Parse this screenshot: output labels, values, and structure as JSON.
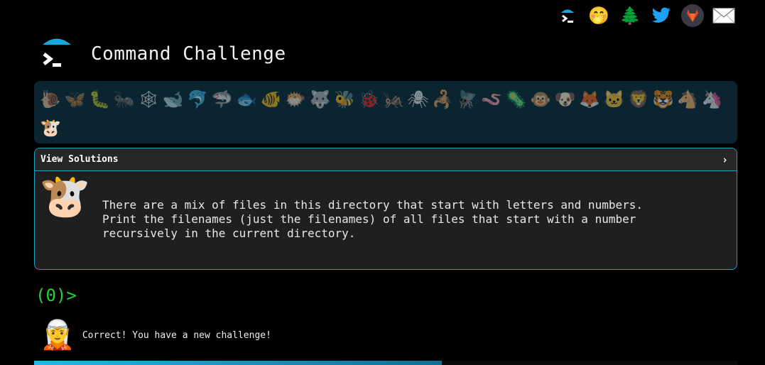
{
  "app": {
    "title": "Command Challenge"
  },
  "top_links": [
    {
      "name": "logo-icon",
      "glyph": "terminal"
    },
    {
      "name": "emoji-icon",
      "glyph": "🤭"
    },
    {
      "name": "tree-icon",
      "glyph": "🌲"
    },
    {
      "name": "twitter-icon",
      "glyph": "twitter-bird"
    },
    {
      "name": "gitlab-icon",
      "glyph": "gitlab-fox"
    },
    {
      "name": "mail-icon",
      "glyph": "✉"
    }
  ],
  "animals": [
    {
      "name": "snail-icon",
      "glyph": "🐌",
      "solved": false
    },
    {
      "name": "butterfly-icon",
      "glyph": "🦋",
      "solved": false
    },
    {
      "name": "caterpillar-icon",
      "glyph": "🐛",
      "solved": false
    },
    {
      "name": "ant-icon",
      "glyph": "🐜",
      "solved": false
    },
    {
      "name": "spiderweb-icon",
      "glyph": "🕸",
      "solved": false
    },
    {
      "name": "whale-icon",
      "glyph": "🐋",
      "solved": false
    },
    {
      "name": "dolphin-icon",
      "glyph": "🐬",
      "solved": false
    },
    {
      "name": "shark-icon",
      "glyph": "🦈",
      "solved": false
    },
    {
      "name": "fish-icon",
      "glyph": "🐟",
      "solved": false
    },
    {
      "name": "tropical-fish-icon",
      "glyph": "🐠",
      "solved": false
    },
    {
      "name": "blowfish-icon",
      "glyph": "🐡",
      "solved": false
    },
    {
      "name": "wolf-icon",
      "glyph": "🐺",
      "solved": false
    },
    {
      "name": "bee-icon",
      "glyph": "🐝",
      "solved": false
    },
    {
      "name": "ladybug-icon",
      "glyph": "🐞",
      "solved": false
    },
    {
      "name": "cricket-icon",
      "glyph": "🦗",
      "solved": false
    },
    {
      "name": "spider-icon",
      "glyph": "🕷",
      "solved": false
    },
    {
      "name": "scorpion-icon",
      "glyph": "🦂",
      "solved": false
    },
    {
      "name": "fly-icon",
      "glyph": "🪰",
      "solved": false
    },
    {
      "name": "worm-icon",
      "glyph": "🪱",
      "solved": false
    },
    {
      "name": "microbe-icon",
      "glyph": "🦠",
      "solved": false
    },
    {
      "name": "monkey-icon",
      "glyph": "🐵",
      "solved": false
    },
    {
      "name": "dog-icon",
      "glyph": "🐶",
      "solved": false
    },
    {
      "name": "fox-icon",
      "glyph": "🦊",
      "solved": false
    },
    {
      "name": "cat-icon",
      "glyph": "🐱",
      "solved": false
    },
    {
      "name": "lion-icon",
      "glyph": "🦁",
      "solved": false
    },
    {
      "name": "tiger-icon",
      "glyph": "🐯",
      "solved": false
    },
    {
      "name": "horse-icon",
      "glyph": "🐴",
      "solved": false
    },
    {
      "name": "unicorn-icon",
      "glyph": "🦄",
      "solved": false
    },
    {
      "name": "cow-icon",
      "glyph": "🐮",
      "solved": true
    }
  ],
  "solutions": {
    "label": "View Solutions",
    "chevron": "›"
  },
  "challenge": {
    "avatar": "🐮",
    "text": "There are a mix of files in this directory that start with letters and numbers.\nPrint the filenames (just the filenames) of all files that start with a number\nrecursively in the current directory."
  },
  "prompt": {
    "text": "(0)>"
  },
  "status": {
    "avatar": "🧝",
    "message": "Correct! You have a new challenge!"
  },
  "progress": {
    "fraction": 0.58
  },
  "colors": {
    "accent": "#1a9fc7",
    "prompt": "#27d13a",
    "background": "#000000"
  }
}
